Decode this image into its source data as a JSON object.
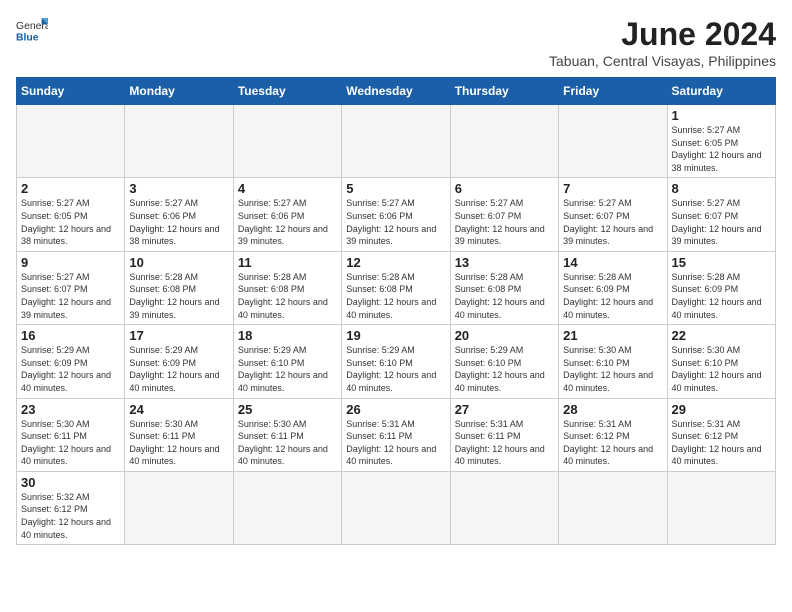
{
  "header": {
    "logo_general": "General",
    "logo_blue": "Blue",
    "month_title": "June 2024",
    "location": "Tabuan, Central Visayas, Philippines"
  },
  "weekdays": [
    "Sunday",
    "Monday",
    "Tuesday",
    "Wednesday",
    "Thursday",
    "Friday",
    "Saturday"
  ],
  "weeks": [
    [
      {
        "day": "",
        "empty": true
      },
      {
        "day": "",
        "empty": true
      },
      {
        "day": "",
        "empty": true
      },
      {
        "day": "",
        "empty": true
      },
      {
        "day": "",
        "empty": true
      },
      {
        "day": "",
        "empty": true
      },
      {
        "day": "1",
        "sunrise": "5:27 AM",
        "sunset": "6:05 PM",
        "daylight": "12 hours and 38 minutes."
      }
    ],
    [
      {
        "day": "2",
        "sunrise": "5:27 AM",
        "sunset": "6:05 PM",
        "daylight": "12 hours and 38 minutes."
      },
      {
        "day": "3",
        "sunrise": "5:27 AM",
        "sunset": "6:06 PM",
        "daylight": "12 hours and 38 minutes."
      },
      {
        "day": "4",
        "sunrise": "5:27 AM",
        "sunset": "6:06 PM",
        "daylight": "12 hours and 39 minutes."
      },
      {
        "day": "5",
        "sunrise": "5:27 AM",
        "sunset": "6:06 PM",
        "daylight": "12 hours and 39 minutes."
      },
      {
        "day": "6",
        "sunrise": "5:27 AM",
        "sunset": "6:07 PM",
        "daylight": "12 hours and 39 minutes."
      },
      {
        "day": "7",
        "sunrise": "5:27 AM",
        "sunset": "6:07 PM",
        "daylight": "12 hours and 39 minutes."
      },
      {
        "day": "8",
        "sunrise": "5:27 AM",
        "sunset": "6:07 PM",
        "daylight": "12 hours and 39 minutes."
      }
    ],
    [
      {
        "day": "9",
        "sunrise": "5:27 AM",
        "sunset": "6:07 PM",
        "daylight": "12 hours and 39 minutes."
      },
      {
        "day": "10",
        "sunrise": "5:28 AM",
        "sunset": "6:08 PM",
        "daylight": "12 hours and 39 minutes."
      },
      {
        "day": "11",
        "sunrise": "5:28 AM",
        "sunset": "6:08 PM",
        "daylight": "12 hours and 40 minutes."
      },
      {
        "day": "12",
        "sunrise": "5:28 AM",
        "sunset": "6:08 PM",
        "daylight": "12 hours and 40 minutes."
      },
      {
        "day": "13",
        "sunrise": "5:28 AM",
        "sunset": "6:08 PM",
        "daylight": "12 hours and 40 minutes."
      },
      {
        "day": "14",
        "sunrise": "5:28 AM",
        "sunset": "6:09 PM",
        "daylight": "12 hours and 40 minutes."
      },
      {
        "day": "15",
        "sunrise": "5:28 AM",
        "sunset": "6:09 PM",
        "daylight": "12 hours and 40 minutes."
      }
    ],
    [
      {
        "day": "16",
        "sunrise": "5:29 AM",
        "sunset": "6:09 PM",
        "daylight": "12 hours and 40 minutes."
      },
      {
        "day": "17",
        "sunrise": "5:29 AM",
        "sunset": "6:09 PM",
        "daylight": "12 hours and 40 minutes."
      },
      {
        "day": "18",
        "sunrise": "5:29 AM",
        "sunset": "6:10 PM",
        "daylight": "12 hours and 40 minutes."
      },
      {
        "day": "19",
        "sunrise": "5:29 AM",
        "sunset": "6:10 PM",
        "daylight": "12 hours and 40 minutes."
      },
      {
        "day": "20",
        "sunrise": "5:29 AM",
        "sunset": "6:10 PM",
        "daylight": "12 hours and 40 minutes."
      },
      {
        "day": "21",
        "sunrise": "5:30 AM",
        "sunset": "6:10 PM",
        "daylight": "12 hours and 40 minutes."
      },
      {
        "day": "22",
        "sunrise": "5:30 AM",
        "sunset": "6:10 PM",
        "daylight": "12 hours and 40 minutes."
      }
    ],
    [
      {
        "day": "23",
        "sunrise": "5:30 AM",
        "sunset": "6:11 PM",
        "daylight": "12 hours and 40 minutes."
      },
      {
        "day": "24",
        "sunrise": "5:30 AM",
        "sunset": "6:11 PM",
        "daylight": "12 hours and 40 minutes."
      },
      {
        "day": "25",
        "sunrise": "5:30 AM",
        "sunset": "6:11 PM",
        "daylight": "12 hours and 40 minutes."
      },
      {
        "day": "26",
        "sunrise": "5:31 AM",
        "sunset": "6:11 PM",
        "daylight": "12 hours and 40 minutes."
      },
      {
        "day": "27",
        "sunrise": "5:31 AM",
        "sunset": "6:11 PM",
        "daylight": "12 hours and 40 minutes."
      },
      {
        "day": "28",
        "sunrise": "5:31 AM",
        "sunset": "6:12 PM",
        "daylight": "12 hours and 40 minutes."
      },
      {
        "day": "29",
        "sunrise": "5:31 AM",
        "sunset": "6:12 PM",
        "daylight": "12 hours and 40 minutes."
      }
    ],
    [
      {
        "day": "30",
        "sunrise": "5:32 AM",
        "sunset": "6:12 PM",
        "daylight": "12 hours and 40 minutes."
      },
      {
        "day": "",
        "empty": true
      },
      {
        "day": "",
        "empty": true
      },
      {
        "day": "",
        "empty": true
      },
      {
        "day": "",
        "empty": true
      },
      {
        "day": "",
        "empty": true
      },
      {
        "day": "",
        "empty": true
      }
    ]
  ]
}
